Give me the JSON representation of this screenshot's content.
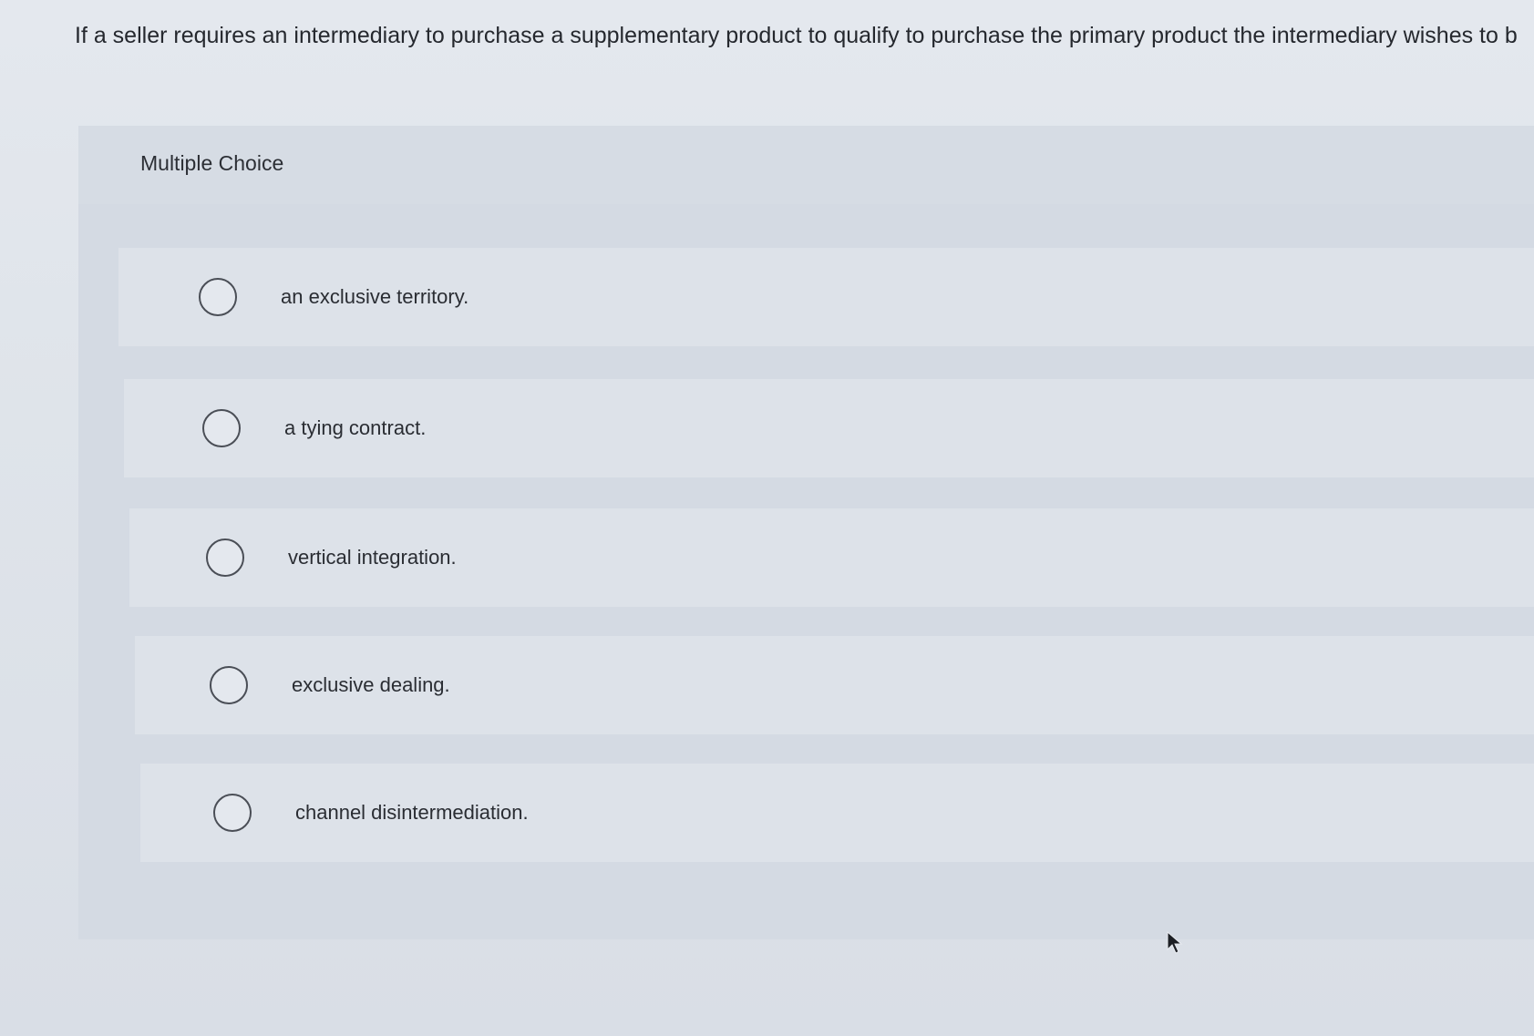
{
  "question": {
    "text": "If a seller requires an intermediary to purchase a supplementary product to qualify to purchase the primary product the intermediary wishes to b"
  },
  "multiple_choice": {
    "label": "Multiple Choice",
    "options": [
      {
        "label": "an exclusive territory.",
        "selected": false
      },
      {
        "label": "a tying contract.",
        "selected": false
      },
      {
        "label": "vertical integration.",
        "selected": false
      },
      {
        "label": "exclusive dealing.",
        "selected": false
      },
      {
        "label": "channel disintermediation.",
        "selected": false
      }
    ]
  },
  "icons": {
    "radio": "radio-unchecked-icon",
    "cursor": "mouse-pointer-icon"
  }
}
